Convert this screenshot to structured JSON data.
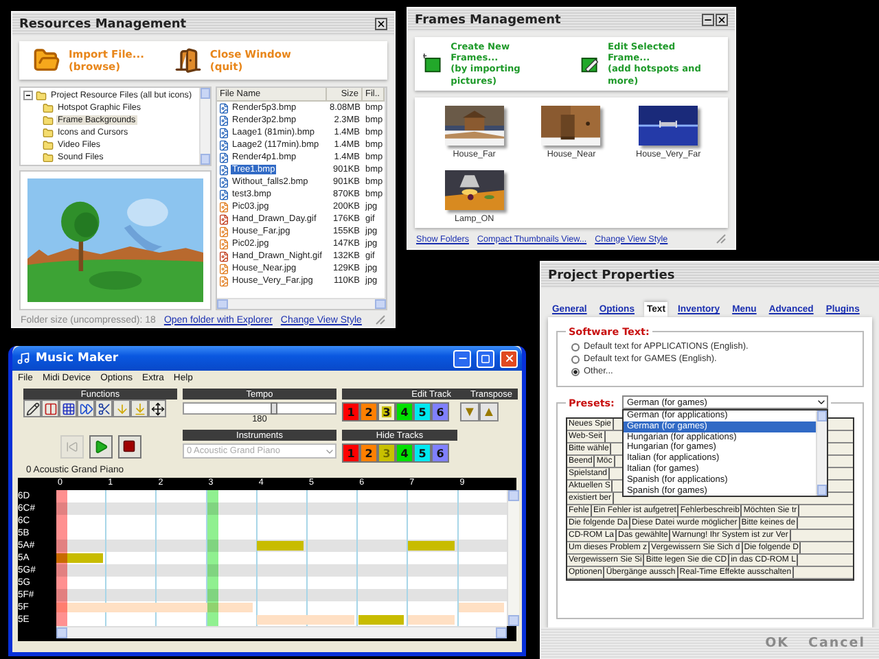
{
  "resources": {
    "title": "Resources Management",
    "actions": [
      {
        "kind": "import",
        "label": "Import File...",
        "sub": "(browse)"
      },
      {
        "kind": "close",
        "label": "Close Window",
        "sub": "(quit)"
      }
    ],
    "tree": {
      "label": "Project Resource Files (all but icons)",
      "expanded": true,
      "children": [
        {
          "label": "Hotspot Graphic Files",
          "selected": false
        },
        {
          "label": "Frame Backgrounds",
          "selected": true
        },
        {
          "label": "Icons and Cursors",
          "selected": false
        },
        {
          "label": "Video Files",
          "selected": false
        },
        {
          "label": "Sound Files",
          "selected": false
        }
      ]
    },
    "columns": [
      "File Name",
      "Size",
      "Fil.."
    ],
    "files": [
      {
        "name": "Render5p3.bmp",
        "size": "8.08MB",
        "type": "bmp",
        "kind": "bitmap",
        "selected": false
      },
      {
        "name": "Render3p2.bmp",
        "size": "2.3MB",
        "type": "bmp",
        "kind": "bitmap",
        "selected": false
      },
      {
        "name": "Laage1 (81min).bmp",
        "size": "1.4MB",
        "type": "bmp",
        "kind": "bitmap",
        "selected": false
      },
      {
        "name": "Laage2 (117min).bmp",
        "size": "1.4MB",
        "type": "bmp",
        "kind": "bitmap",
        "selected": false
      },
      {
        "name": "Render4p1.bmp",
        "size": "1.4MB",
        "type": "bmp",
        "kind": "bitmap",
        "selected": false
      },
      {
        "name": "Tree1.bmp",
        "size": "901KB",
        "type": "bmp",
        "kind": "bitmap",
        "selected": true
      },
      {
        "name": "Without_falls2.bmp",
        "size": "901KB",
        "type": "bmp",
        "kind": "bitmap",
        "selected": false
      },
      {
        "name": "test3.bmp",
        "size": "870KB",
        "type": "bmp",
        "kind": "bitmap",
        "selected": false
      },
      {
        "name": "Pic03.jpg",
        "size": "200KB",
        "type": "jpg",
        "selected": false
      },
      {
        "name": "Hand_Drawn_Day.gif",
        "size": "176KB",
        "type": "gif",
        "kind": "gif",
        "selected": false
      },
      {
        "name": "House_Far.jpg",
        "size": "155KB",
        "type": "jpg",
        "selected": false
      },
      {
        "name": "Pic02.jpg",
        "size": "147KB",
        "type": "jpg",
        "selected": false
      },
      {
        "name": "Hand_Drawn_Night.gif",
        "size": "132KB",
        "type": "gif",
        "kind": "gif",
        "selected": false
      },
      {
        "name": "House_Near.jpg",
        "size": "129KB",
        "type": "jpg",
        "selected": false
      },
      {
        "name": "House_Very_Far.jpg",
        "size": "110KB",
        "type": "jpg",
        "selected": false
      }
    ],
    "info": "Folder size (uncompressed): 18",
    "links": [
      "Open folder with Explorer",
      "Change View Style"
    ]
  },
  "frames": {
    "title": "Frames Management",
    "actions": [
      {
        "kind": "create",
        "label": "Create New Frames...",
        "sub": "(by importing pictures)"
      },
      {
        "kind": "edit",
        "label": "Edit Selected Frame...",
        "sub": "(add hotspots and more)"
      }
    ],
    "thumbnails": [
      {
        "label": "House_Far"
      },
      {
        "label": "House_Near"
      },
      {
        "label": "House_Very_Far"
      },
      {
        "label": "Lamp_ON"
      }
    ],
    "links": [
      "Show Folders",
      "Compact Thumbnails View...",
      "Change View Style"
    ]
  },
  "music": {
    "title": "Music Maker",
    "menu": [
      "File",
      "Midi Device",
      "Options",
      "Extra",
      "Help"
    ],
    "functions": {
      "label": "Functions",
      "tools": [
        {
          "kind": "pencil"
        },
        {
          "kind": "marker"
        },
        {
          "kind": "grid"
        },
        {
          "kind": "forward"
        },
        {
          "kind": "cut"
        },
        {
          "kind": "drop"
        },
        {
          "kind": "drop-line"
        },
        {
          "kind": "move"
        }
      ]
    },
    "tempo": {
      "label": "Tempo",
      "level": 0.6,
      "reading": "180"
    },
    "edit_track": {
      "label": "Edit Track",
      "tracks": [
        {
          "label": "1",
          "color": "#ff0000",
          "selected": false
        },
        {
          "label": "2",
          "color": "#ff8000",
          "selected": false
        },
        {
          "label": "3",
          "color": "#c8c000",
          "selected": true
        },
        {
          "label": "4",
          "color": "#00e000",
          "selected": false
        },
        {
          "label": "5",
          "color": "#00e8f0",
          "selected": false
        },
        {
          "label": "6",
          "color": "#8080ff",
          "selected": false
        }
      ]
    },
    "transpose": {
      "label": "Transpose",
      "buttons": [
        "▼",
        "▲"
      ]
    },
    "transport": [
      {
        "kind": "rewind",
        "disabled": true
      },
      {
        "kind": "play",
        "disabled": false
      },
      {
        "kind": "stop",
        "disabled": false
      }
    ],
    "instruments": {
      "label": "Instruments",
      "value": "0 Acoustic Grand Piano",
      "disabled": true
    },
    "hide_tracks": {
      "label": "Hide Tracks",
      "tracks": [
        {
          "label": "1",
          "color": "#ff0000",
          "hidden": false
        },
        {
          "label": "2",
          "color": "#ff8000",
          "hidden": false
        },
        {
          "label": "3",
          "color": "#c8c000",
          "hidden": true
        },
        {
          "label": "4",
          "color": "#00e000",
          "hidden": false
        },
        {
          "label": "5",
          "color": "#00e8f0",
          "hidden": false
        },
        {
          "label": "6",
          "color": "#8080ff",
          "hidden": false
        }
      ]
    },
    "caption": "0 Acoustic Grand Piano",
    "roll": {
      "beats": [
        {
          "label": "0",
          "color": "#ff9090"
        },
        {
          "label": "1"
        },
        {
          "label": "2"
        },
        {
          "label": "3",
          "color": "#90f090"
        },
        {
          "label": "4"
        },
        {
          "label": "5"
        },
        {
          "label": "6"
        },
        {
          "label": "7"
        },
        {
          "label": "9"
        }
      ],
      "rows": [
        {
          "label": "6D",
          "sharp": false
        },
        {
          "label": "6C#",
          "sharp": true
        },
        {
          "label": "6C",
          "sharp": false
        },
        {
          "label": "5B",
          "sharp": false
        },
        {
          "label": "5A#",
          "sharp": true,
          "cells": [
            null,
            null,
            null,
            null,
            {
              "color": "#c8bc00"
            },
            null,
            null,
            {
              "color": "#c8bc00"
            },
            null
          ]
        },
        {
          "label": "5A",
          "sharp": false,
          "cells": [
            {
              "color": "#c8bc00"
            },
            null,
            null,
            null,
            null,
            null,
            null,
            null,
            null
          ]
        },
        {
          "label": "5G#",
          "sharp": true
        },
        {
          "label": "5G",
          "sharp": false
        },
        {
          "label": "5F#",
          "sharp": true
        },
        {
          "label": "5F",
          "sharp": false,
          "cells": [
            {
              "color": "#ffe0c4"
            },
            {
              "color": "#ffe0c4"
            },
            {
              "color": "#ffe0c4"
            },
            {
              "color": "#ffe0c4"
            },
            null,
            null,
            null,
            null,
            {
              "color": "#ffe0c4"
            }
          ]
        },
        {
          "label": "5E",
          "sharp": false,
          "cells": [
            null,
            null,
            null,
            null,
            {
              "color": "#ffe0c4"
            },
            {
              "color": "#ffe0c4"
            },
            {
              "color": "#c8bc00"
            },
            {
              "color": "#ffe0c4"
            },
            null
          ]
        }
      ]
    }
  },
  "properties": {
    "title": "Project Properties",
    "tabs": [
      {
        "label": "General",
        "selected": false
      },
      {
        "label": "Options",
        "selected": false
      },
      {
        "label": "Text",
        "selected": true
      },
      {
        "label": "Inventory",
        "selected": false
      },
      {
        "label": "Menu",
        "selected": false
      },
      {
        "label": "Advanced",
        "selected": false
      },
      {
        "label": "Plugins",
        "selected": false
      }
    ],
    "software_text": {
      "label": "Software Text:",
      "options": [
        {
          "label": "Default text for APPLICATIONS (English).",
          "selected": false
        },
        {
          "label": "Default text for GAMES (English).",
          "selected": false
        },
        {
          "label": "Other...",
          "selected": true
        }
      ]
    },
    "presets": {
      "label": "Presets:",
      "value": "German (for games)",
      "expanded": true,
      "options": [
        {
          "label": "German (for applications)",
          "selected": false
        },
        {
          "label": "German (for games)",
          "selected": true
        },
        {
          "label": "Hungarian (for applications)",
          "selected": false
        },
        {
          "label": "Hungarian (for games)",
          "selected": false
        },
        {
          "label": "Italian (for applications)",
          "selected": false
        },
        {
          "label": "Italian (for games)",
          "selected": false
        },
        {
          "label": "Spanish (for applications)",
          "selected": false
        },
        {
          "label": "Spanish (for games)",
          "selected": false
        }
      ]
    },
    "table": [
      [
        "Neues Spie"
      ],
      [
        "Web-Seit"
      ],
      [
        "Bitte wähle"
      ],
      [
        "Beend",
        "Möc"
      ],
      [
        "Spielstand"
      ],
      [
        "Aktuellen S"
      ],
      [
        "existiert ber"
      ],
      [
        "Fehle",
        "Ein Fehler ist aufgetret",
        "Fehlerbeschreib",
        "Möchten Sie tr"
      ],
      [
        "Die folgende Da",
        "Diese Datei wurde möglicher",
        "Bitte keines de"
      ],
      [
        "CD-ROM La",
        "Das gewählte",
        "Warnung! Ihr System ist zur Ver"
      ],
      [
        "Um dieses Problem z",
        "Vergewissern Sie Sich d",
        "Die folgende D"
      ],
      [
        "Vergewissern Sie Si",
        "Bitte legen Sie die CD",
        "in das CD-ROM L"
      ],
      [
        "Optionen",
        "Übergänge aussch",
        "Real-Time Effekte ausschalten"
      ]
    ],
    "buttons": [
      "OK",
      "Cancel"
    ]
  }
}
